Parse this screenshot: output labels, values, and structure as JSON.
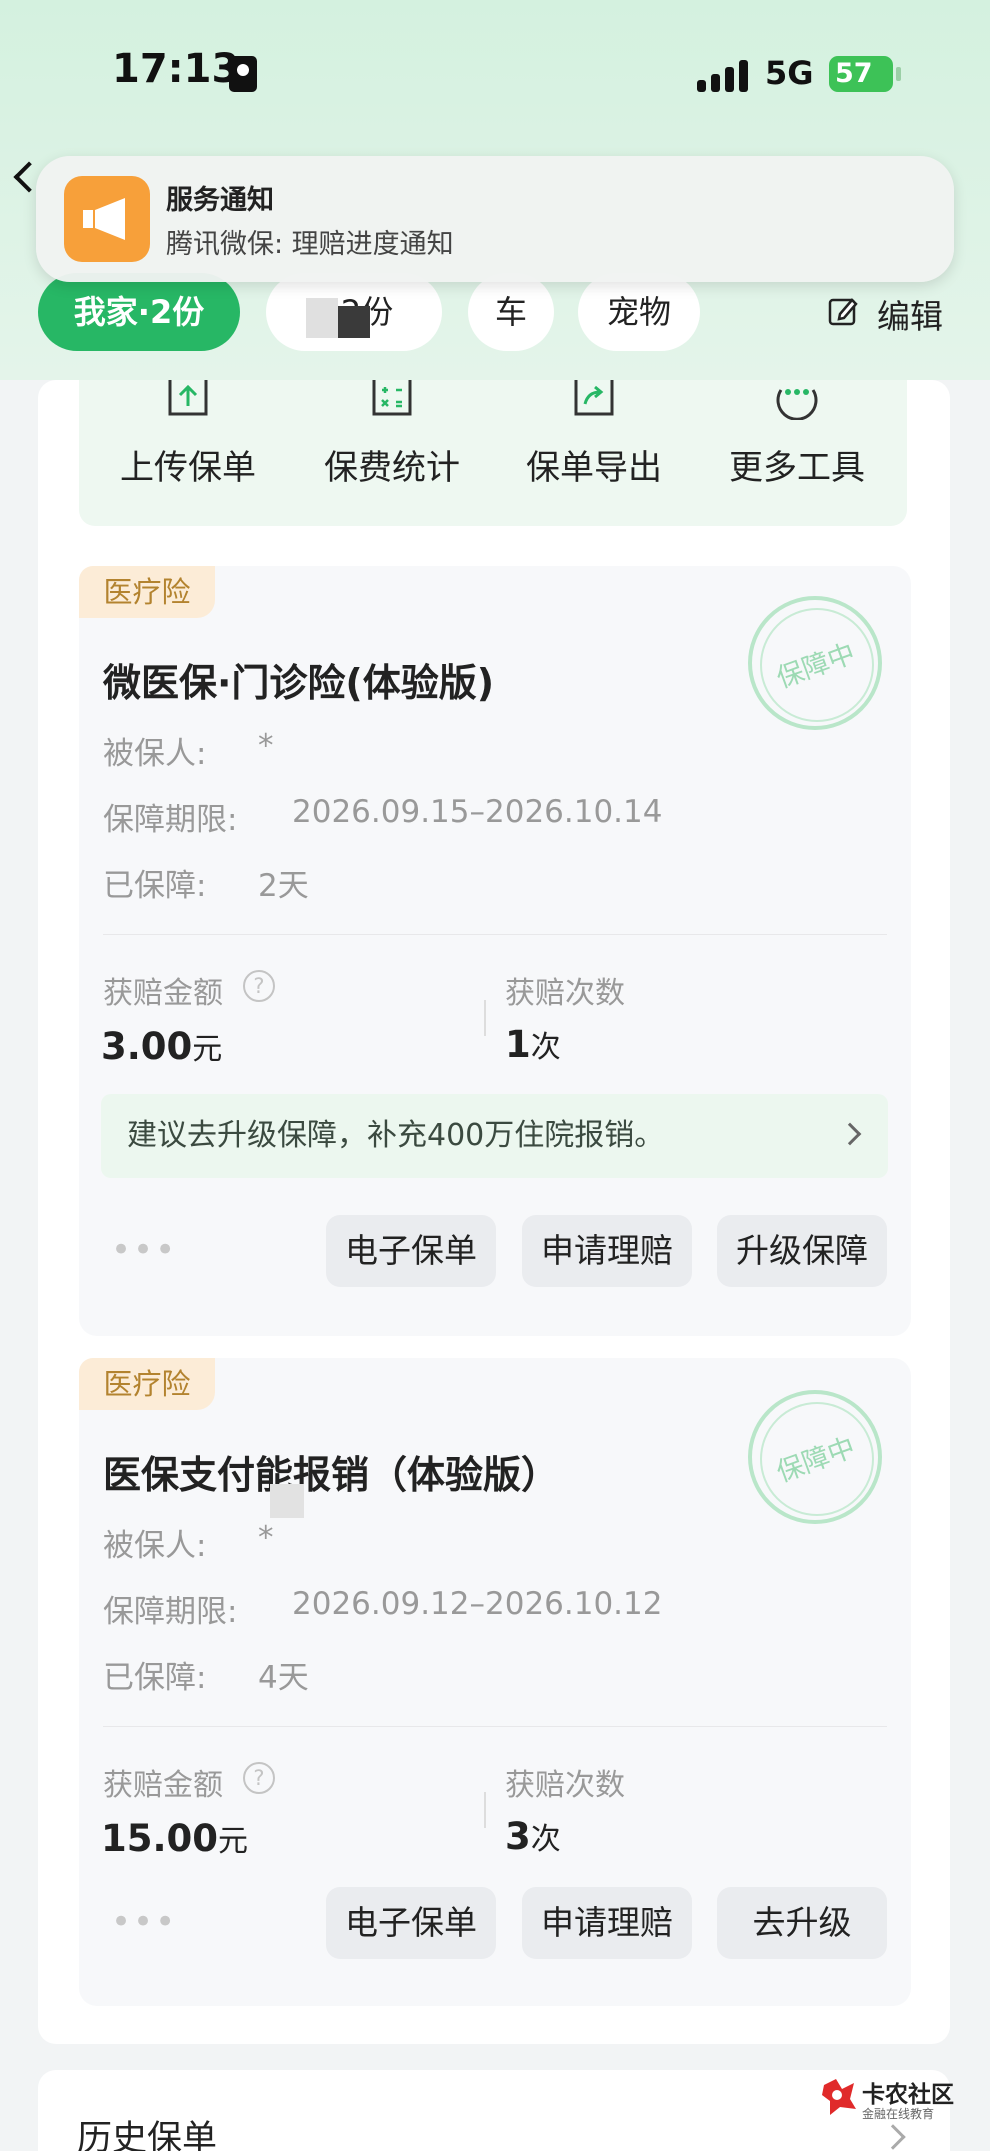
{
  "status_bar": {
    "time": "17:13",
    "network": "5G",
    "battery": "57"
  },
  "notification": {
    "title": "服务通知",
    "body": "腾讯微保: 理赔进度通知",
    "icon": "megaphone-icon",
    "icon_color": "#f7a03a"
  },
  "tabs": [
    {
      "label": "我家·2份",
      "active": true
    },
    {
      "label": "*   2份",
      "active": false
    },
    {
      "label": "车",
      "active": false
    },
    {
      "label": "宠物",
      "active": false
    }
  ],
  "edit_label": "编辑",
  "tools": [
    {
      "label": "上传保单",
      "icon": "upload-icon"
    },
    {
      "label": "保费统计",
      "icon": "calculator-icon"
    },
    {
      "label": "保单导出",
      "icon": "export-icon"
    },
    {
      "label": "更多工具",
      "icon": "more-icon"
    }
  ],
  "policies": [
    {
      "tag": "医疗险",
      "title": "微医保·门诊险(体验版)",
      "stamp": "保障中",
      "insured_label": "被保人:",
      "insured_value": "*",
      "period_label": "保障期限:",
      "period_value": "2026.09.15–2026.10.14",
      "covered_label": "已保障:",
      "covered_value": "2天",
      "claim_amount_label": "获赔金额",
      "claim_amount": "3.00",
      "claim_amount_unit": "元",
      "claim_count_label": "获赔次数",
      "claim_count": "1",
      "claim_count_unit": "次",
      "suggestion": "建议去升级保障，补充400万住院报销。",
      "buttons": [
        "电子保单",
        "申请理赔",
        "升级保障"
      ]
    },
    {
      "tag": "医疗险",
      "title": "医保支付能报销（体验版）",
      "stamp": "保障中",
      "insured_label": "被保人:",
      "insured_value": "*",
      "period_label": "保障期限:",
      "period_value": "2026.09.12–2026.10.12",
      "covered_label": "已保障:",
      "covered_value": "4天",
      "claim_amount_label": "获赔金额",
      "claim_amount": "15.00",
      "claim_amount_unit": "元",
      "claim_count_label": "获赔次数",
      "claim_count": "3",
      "claim_count_unit": "次",
      "buttons": [
        "电子保单",
        "申请理赔",
        "去升级"
      ]
    }
  ],
  "history_label": "历史保单",
  "watermark": {
    "name": "卡农社区",
    "sub": "金融在线教育"
  },
  "colors": {
    "accent": "#27b765",
    "tag_bg": "#fcecd7",
    "tag_text": "#b3832f"
  }
}
